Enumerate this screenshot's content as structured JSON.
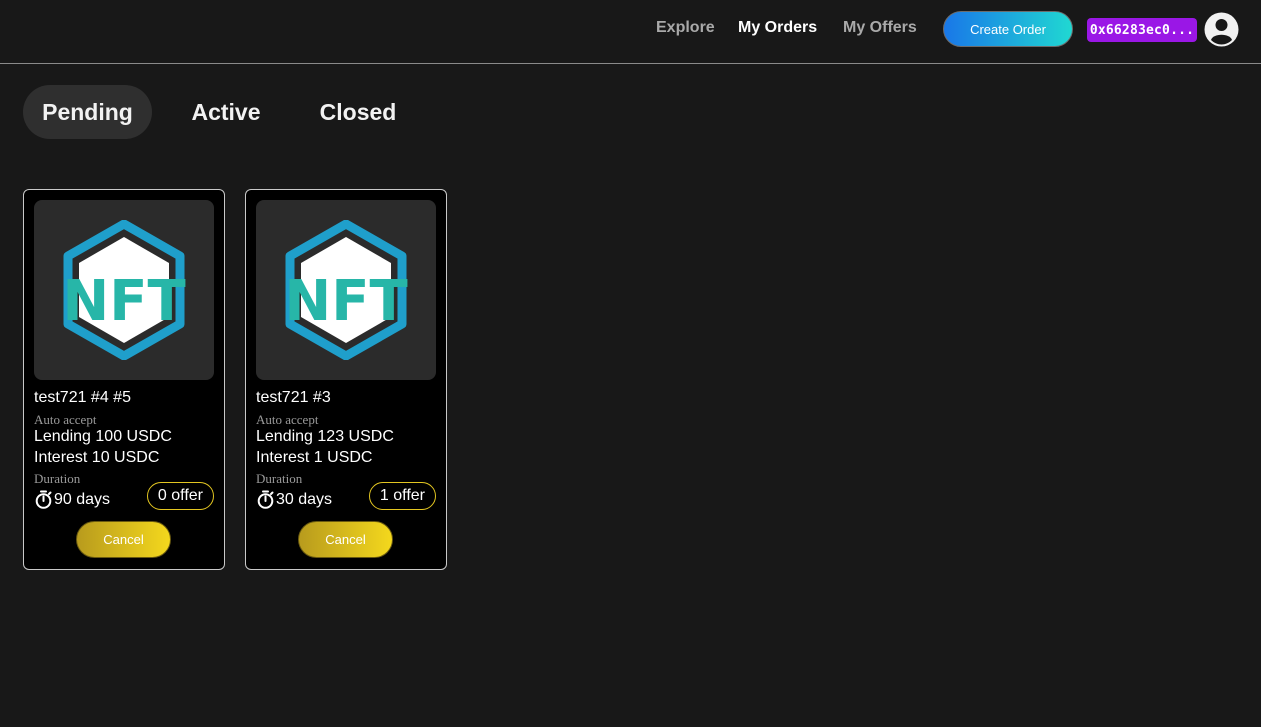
{
  "header": {
    "nav": {
      "explore": "Explore",
      "my_orders": "My Orders",
      "my_offers": "My Offers"
    },
    "active_nav": "My Orders",
    "create_order_label": "Create Order",
    "wallet_address": "0x66283ec0...",
    "avatar_icon": "user-circle-icon"
  },
  "tabs": {
    "pending": "Pending",
    "active": "Active",
    "closed": "Closed",
    "selected": "Pending"
  },
  "orders": [
    {
      "name": "test721 #4 #5",
      "image_icon": "nft-logo-icon",
      "image_text": "NFT",
      "auto_accept_label": "Auto accept",
      "lending": "Lending 100 USDC",
      "interest": "Interest 10 USDC",
      "duration_label": "Duration",
      "duration_value": "90 days",
      "offers": "0 offer",
      "cancel_label": "Cancel"
    },
    {
      "name": "test721 #3",
      "image_icon": "nft-logo-icon",
      "image_text": "NFT",
      "auto_accept_label": "Auto accept",
      "lending": "Lending 123 USDC",
      "interest": "Interest 1 USDC",
      "duration_label": "Duration",
      "duration_value": "30 days",
      "offers": "1 offer",
      "cancel_label": "Cancel"
    }
  ],
  "colors": {
    "background": "#181818",
    "card_background": "#000000",
    "wallet_badge": "#9a17e6",
    "create_gradient_start": "#1977e8",
    "create_gradient_end": "#20d8d2",
    "cancel_gradient_start": "#b89b1d",
    "cancel_gradient_end": "#f4d81d",
    "offer_border": "#e3c621",
    "nft_hex": "#1f9fcb",
    "nft_letters": "#27b6a8"
  }
}
